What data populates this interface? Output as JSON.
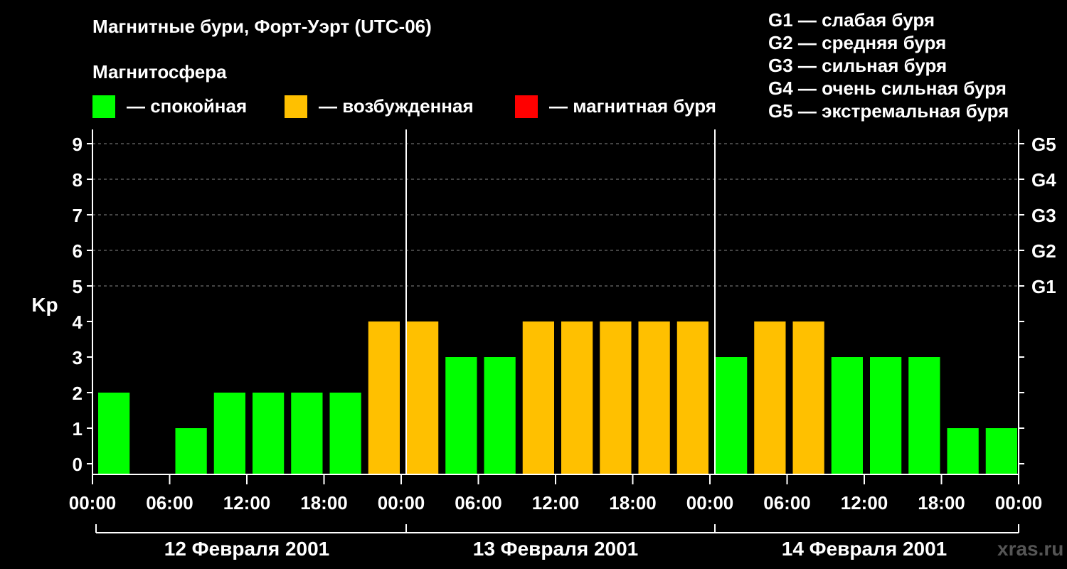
{
  "title": "Магнитные бури, Форт-Уэрт (UTC-06)",
  "legend": {
    "title": "Магнитосфера",
    "items": [
      {
        "label": "— спокойная",
        "color": "#00ff00"
      },
      {
        "label": "— возбужденная",
        "color": "#ffc000"
      },
      {
        "label": "— магнитная буря",
        "color": "#ff0000"
      }
    ]
  },
  "storm_scale": [
    "G1 — слабая буря",
    "G2 — средняя буря",
    "G3 — сильная буря",
    "G4 — очень сильная буря",
    "G5 — экстремальная буря"
  ],
  "watermark": "xras.ru",
  "chart_data": {
    "type": "bar",
    "ylabel": "Kp",
    "ylim": [
      0,
      9
    ],
    "yticks": [
      0,
      1,
      2,
      3,
      4,
      5,
      6,
      7,
      8,
      9
    ],
    "right_ticks": [
      {
        "value": 5,
        "label": "G1"
      },
      {
        "value": 6,
        "label": "G2"
      },
      {
        "value": 7,
        "label": "G3"
      },
      {
        "value": 8,
        "label": "G4"
      },
      {
        "value": 9,
        "label": "G5"
      }
    ],
    "xtick_labels": [
      "00:00",
      "06:00",
      "12:00",
      "18:00",
      "00:00",
      "06:00",
      "12:00",
      "18:00",
      "00:00",
      "06:00",
      "12:00",
      "18:00",
      "00:00"
    ],
    "days": [
      "12 Февраля 2001",
      "13 Февраля 2001",
      "14 Февраля 2001"
    ],
    "bar_hours": 3,
    "values": [
      2,
      0,
      1,
      2,
      2,
      2,
      2,
      4,
      4,
      3,
      3,
      4,
      4,
      4,
      4,
      4,
      3,
      4,
      4,
      3,
      3,
      3,
      1,
      1
    ],
    "color_rules": [
      {
        "max": 3,
        "color": "#00ff00"
      },
      {
        "max": 4,
        "color": "#ffc000"
      },
      {
        "max": 9,
        "color": "#ff0000"
      }
    ],
    "grid": true
  }
}
